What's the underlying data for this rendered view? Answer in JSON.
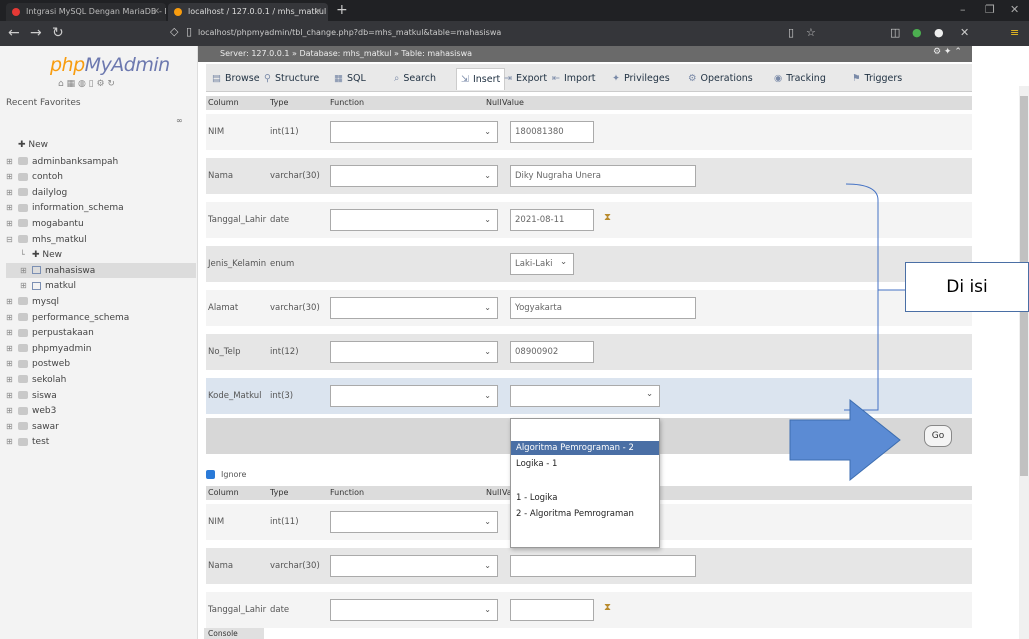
{
  "browser": {
    "tabs": [
      {
        "title": "Intgrasi MySQL Dengan MariaDB - Memori ...",
        "favicon_color": "#e53935"
      },
      {
        "title": "localhost / 127.0.0.1 / mhs_matkul | ...",
        "favicon_color": "#f89c0e"
      }
    ],
    "new_tab_label": "+",
    "url": "localhost/phpmyadmin/tbl_change.php?db=mhs_matkul&table=mahasiswa",
    "window_controls": [
      "–",
      "❐",
      "✕"
    ]
  },
  "sidebar": {
    "logo_php": "php",
    "logo_myadmin": "MyAdmin",
    "tabs_label": "Recent   Favorites",
    "link_icon": "∞",
    "databases": [
      {
        "label": "New",
        "level": 0,
        "type": "new"
      },
      {
        "label": "adminbanksampah",
        "level": 0,
        "type": "db"
      },
      {
        "label": "contoh",
        "level": 0,
        "type": "db"
      },
      {
        "label": "dailylog",
        "level": 0,
        "type": "db"
      },
      {
        "label": "information_schema",
        "level": 0,
        "type": "db"
      },
      {
        "label": "mogabantu",
        "level": 0,
        "type": "db"
      },
      {
        "label": "mhs_matkul",
        "level": 0,
        "type": "db",
        "expanded": true
      },
      {
        "label": "New",
        "level": 1,
        "type": "new"
      },
      {
        "label": "mahasiswa",
        "level": 1,
        "type": "table",
        "selected": true
      },
      {
        "label": "matkul",
        "level": 1,
        "type": "table"
      },
      {
        "label": "mysql",
        "level": 0,
        "type": "db"
      },
      {
        "label": "performance_schema",
        "level": 0,
        "type": "db"
      },
      {
        "label": "perpustakaan",
        "level": 0,
        "type": "db"
      },
      {
        "label": "phpmyadmin",
        "level": 0,
        "type": "db"
      },
      {
        "label": "postweb",
        "level": 0,
        "type": "db"
      },
      {
        "label": "sekolah",
        "level": 0,
        "type": "db"
      },
      {
        "label": "siswa",
        "level": 0,
        "type": "db"
      },
      {
        "label": "web3",
        "level": 0,
        "type": "db"
      },
      {
        "label": "sawar",
        "level": 0,
        "type": "db"
      },
      {
        "label": "test",
        "level": 0,
        "type": "db"
      }
    ]
  },
  "main": {
    "breadcrumb": "Server: 127.0.0.1 » Database: mhs_matkul » Table: mahasiswa",
    "tabs": [
      {
        "label": "Browse",
        "icon": "▤"
      },
      {
        "label": "Structure",
        "icon": "⚲"
      },
      {
        "label": "SQL",
        "icon": "▦"
      },
      {
        "label": "Search",
        "icon": "⌕"
      },
      {
        "label": "Insert",
        "icon": "⇲",
        "active": true
      },
      {
        "label": "Export",
        "icon": "⇥"
      },
      {
        "label": "Import",
        "icon": "⇤"
      },
      {
        "label": "Privileges",
        "icon": "✦"
      },
      {
        "label": "Operations",
        "icon": "⚙"
      },
      {
        "label": "Tracking",
        "icon": "◉"
      },
      {
        "label": "Triggers",
        "icon": "⚑"
      }
    ],
    "headers": {
      "column": "Column",
      "type": "Type",
      "function": "Function",
      "null": "Null",
      "value": "Value"
    },
    "rows": [
      {
        "column": "NIM",
        "type": "int(11)",
        "value": "180081380",
        "input": "text",
        "width": 84
      },
      {
        "column": "Nama",
        "type": "varchar(30)",
        "value": "Diky Nugraha Unera",
        "input": "text",
        "width": 186
      },
      {
        "column": "Tanggal_Lahir",
        "type": "date",
        "value": "2021-08-11",
        "input": "date",
        "width": 84
      },
      {
        "column": "Jenis_Kelamin",
        "type": "enum",
        "value": "Laki-Laki",
        "input": "select",
        "width": 64
      },
      {
        "column": "Alamat",
        "type": "varchar(30)",
        "value": "Yogyakarta",
        "input": "text",
        "width": 186
      },
      {
        "column": "No_Telp",
        "type": "int(12)",
        "value": "08900902",
        "input": "text",
        "width": 84
      },
      {
        "column": "Kode_Matkul",
        "type": "int(3)",
        "value": "",
        "input": "select",
        "width": 150
      }
    ],
    "go_label": "Go",
    "ignore_label": "Ignore",
    "dropdown_options": [
      "",
      "Algoritma Pemrograman - 2",
      "Logika - 1",
      "",
      "1 - Logika",
      "2 - Algoritma Pemrograman"
    ],
    "dropdown_selected": 1,
    "rows2": [
      {
        "column": "NIM",
        "type": "int(11)",
        "value": "",
        "input": "text",
        "width": 84
      },
      {
        "column": "Nama",
        "type": "varchar(30)",
        "value": "",
        "input": "text",
        "width": 186
      },
      {
        "column": "Tanggal_Lahir",
        "type": "date",
        "value": "",
        "input": "date",
        "width": 84
      }
    ],
    "console_label": "Console"
  },
  "annotation": {
    "text": "Di isi",
    "arrow_color": "#4472c4"
  }
}
